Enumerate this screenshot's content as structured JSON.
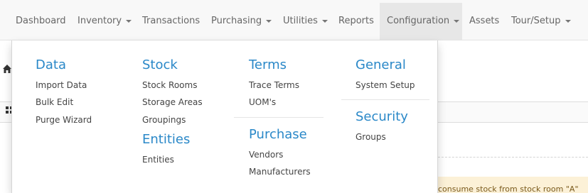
{
  "navbar": {
    "items": [
      {
        "label": "Dashboard"
      },
      {
        "label": "Inventory"
      },
      {
        "label": "Transactions"
      },
      {
        "label": "Purchasing"
      },
      {
        "label": "Utilities"
      },
      {
        "label": "Reports"
      },
      {
        "label": "Configuration"
      },
      {
        "label": "Assets"
      },
      {
        "label": "Tour/Setup"
      }
    ]
  },
  "menu": {
    "data": {
      "heading": "Data",
      "links": [
        "Import Data",
        "Bulk Edit",
        "Purge Wizard"
      ]
    },
    "stock": {
      "heading": "Stock",
      "links": [
        "Stock Rooms",
        "Storage Areas",
        "Groupings"
      ]
    },
    "entities": {
      "heading": "Entities",
      "links": [
        "Entities"
      ]
    },
    "terms": {
      "heading": "Terms",
      "links": [
        "Trace Terms",
        "UOM's"
      ]
    },
    "purchase": {
      "heading": "Purchase",
      "links": [
        "Vendors",
        "Manufacturers"
      ]
    },
    "general": {
      "heading": "General",
      "links": [
        "System Setup"
      ]
    },
    "security": {
      "heading": "Security",
      "links": [
        "Groups"
      ]
    }
  },
  "background": {
    "alert_text": "consume stock from stock room \"A\""
  },
  "colors": {
    "accent": "#2a88c8",
    "alert_bg": "#fcf1d7"
  }
}
